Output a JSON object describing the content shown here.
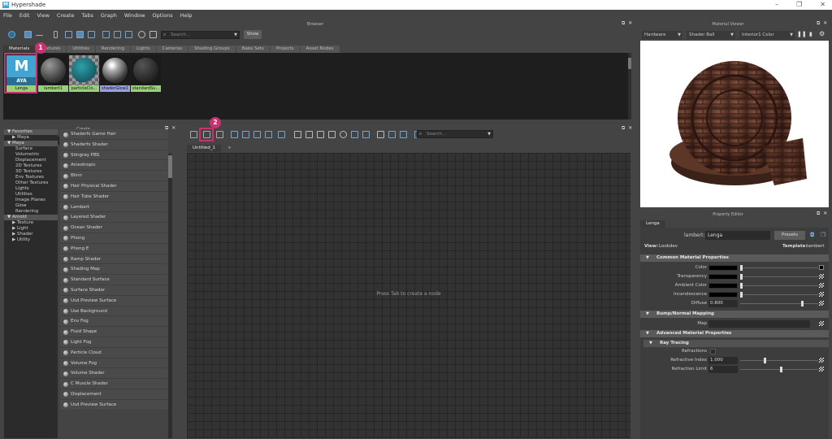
{
  "window": {
    "app_icon": "M",
    "title": "Hypershade",
    "minimize": "–",
    "restore": "❐",
    "close": "✕"
  },
  "menu": [
    "File",
    "Edit",
    "View",
    "Create",
    "Tabs",
    "Graph",
    "Window",
    "Options",
    "Help"
  ],
  "browser": {
    "title": "Browser",
    "search_placeholder": "Search...",
    "show_button": "Show",
    "tabs": [
      "Materials",
      "Textures",
      "Utilities",
      "Rendering",
      "Lights",
      "Cameras",
      "Shading Groups",
      "Bake Sets",
      "Projects",
      "Asset Nodes"
    ],
    "swatches": [
      {
        "label": "Lenga",
        "kind": "maya-logo",
        "logo_letter": "M",
        "logo_text": "AYA"
      },
      {
        "label": "lambert1",
        "kind": "sphere"
      },
      {
        "label": "particleClo...",
        "kind": "checker"
      },
      {
        "label": "shaderGlow1",
        "kind": "glow"
      },
      {
        "label": "standardSu...",
        "kind": "dark"
      }
    ]
  },
  "create": {
    "title": "Create",
    "tree": [
      {
        "label": "Favorites",
        "level": 0
      },
      {
        "label": "Maya",
        "level": 1
      },
      {
        "label": "Maya",
        "level": 0
      },
      {
        "label": "Surface",
        "level": 2
      },
      {
        "label": "Volumetric",
        "level": 2
      },
      {
        "label": "Displacement",
        "level": 2
      },
      {
        "label": "2D Textures",
        "level": 2
      },
      {
        "label": "3D Textures",
        "level": 2
      },
      {
        "label": "Env Textures",
        "level": 2
      },
      {
        "label": "Other Textures",
        "level": 2
      },
      {
        "label": "Lights",
        "level": 2
      },
      {
        "label": "Utilities",
        "level": 2
      },
      {
        "label": "Image Planes",
        "level": 2
      },
      {
        "label": "Glow",
        "level": 2
      },
      {
        "label": "Rendering",
        "level": 2
      },
      {
        "label": "Arnold",
        "level": 0
      },
      {
        "label": "Texture",
        "level": 1
      },
      {
        "label": "Light",
        "level": 1
      },
      {
        "label": "Shader",
        "level": 1
      },
      {
        "label": "Utility",
        "level": 1
      }
    ],
    "nodes": [
      "Shaderfx Game Hair",
      "Shaderfx Shader",
      "Stingray PBS",
      "Anisotropic",
      "Blinn",
      "Hair Physical Shader",
      "Hair Tube Shader",
      "Lambert",
      "Layered Shader",
      "Ocean Shader",
      "Phong",
      "Phong E",
      "Ramp Shader",
      "Shading Map",
      "Standard Surface",
      "Surface Shader",
      "Usd Preview Surface",
      "Use Background",
      "Env Fog",
      "Fluid Shape",
      "Light Fog",
      "Particle Cloud",
      "Volume Fog",
      "Volume Shader",
      "C Muscle Shader",
      "Displacement",
      "Usd Preview Surface"
    ]
  },
  "graph": {
    "search_placeholder": "Search...",
    "tabs": [
      "Untitled_1"
    ],
    "add_tab": "+",
    "hint": "Press Tab to create a node"
  },
  "material_viewer": {
    "title": "Material Viewer",
    "renderer": "Hardware",
    "geometry": "Shader Ball",
    "environment": "Interior1 Color"
  },
  "property_editor": {
    "title": "Property Editor",
    "tab": "Lenga",
    "node_type": "lambert:",
    "node_name": "Lenga",
    "presets": "Presets",
    "view_label": "View:",
    "view_value": "Lookdev",
    "template_label": "Template:",
    "template_value": "lambert",
    "sections": {
      "common": "Common Material Properties",
      "bump": "Bump/Normal Mapping",
      "advanced": "Advanced Material Properties",
      "raytracing": "Ray Tracing"
    },
    "attrs": {
      "color": "Color",
      "transparency": "Transparency",
      "ambient": "Ambient Color",
      "incandescence": "Incandescence",
      "diffuse": "Diffuse",
      "diffuse_value": "0.800",
      "map": "Map",
      "refractions": "Refractions",
      "refractive_index": "Refractive Index",
      "refractive_index_value": "1.000",
      "refraction_limit": "Refraction Limit",
      "refraction_limit_value": "6"
    }
  },
  "annotations": [
    "1",
    "2"
  ],
  "colors": {
    "accent": "#c8326e",
    "panel": "#444444",
    "dark": "#2b2b2b",
    "graph_bg": "#323232"
  }
}
